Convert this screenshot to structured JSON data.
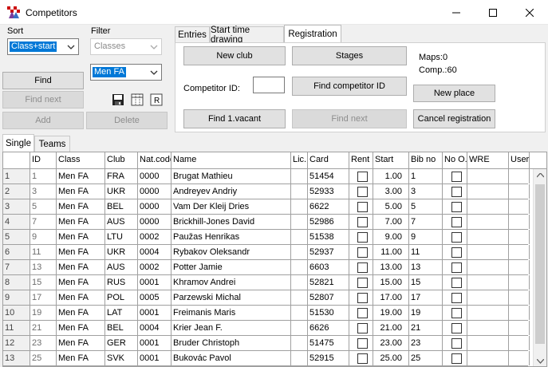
{
  "window": {
    "title": "Competitors",
    "icon": "app-icon"
  },
  "sort": {
    "label": "Sort",
    "value": "Class+start"
  },
  "filter": {
    "label": "Filter",
    "class_filter": "Classes",
    "class_value": "Men FA"
  },
  "left_buttons": {
    "find": "Find",
    "find_next": "Find next",
    "add": "Add",
    "delete": "Delete"
  },
  "small_icons": [
    "save-icon",
    "columns-icon",
    "report-icon"
  ],
  "top_tabs": [
    "Entries",
    "Start time drawing",
    "Registration"
  ],
  "registration": {
    "new_club": "New club",
    "stages": "Stages",
    "maps": "Maps:0",
    "comp": "Comp.:60",
    "competitor_id_label": "Competitor ID:",
    "competitor_id_value": "",
    "find_competitor_id": "Find competitor ID",
    "new_place": "New place",
    "find_first_vacant": "Find 1.vacant",
    "find_next": "Find next",
    "cancel_registration": "Cancel registration"
  },
  "bottom_tabs": [
    "Single",
    "Teams"
  ],
  "table": {
    "columns": [
      "",
      "ID",
      "Class",
      "Club",
      "Nat.code",
      "Name",
      "Lic.",
      "Card",
      "Rent",
      "Start",
      "Bib no",
      "No O.",
      "WRE",
      "User"
    ],
    "rows": [
      [
        "1",
        "1",
        "Men FA",
        "FRA",
        "0000",
        "Brugat Mathieu",
        "",
        "51454",
        "",
        "1.00",
        "1",
        "",
        "",
        ""
      ],
      [
        "2",
        "3",
        "Men FA",
        "UKR",
        "0000",
        "Andreyev Andriy",
        "",
        "52933",
        "",
        "3.00",
        "3",
        "",
        "",
        ""
      ],
      [
        "3",
        "5",
        "Men FA",
        "BEL",
        "0000",
        "Vam Der Kleij Dries",
        "",
        "6622",
        "",
        "5.00",
        "5",
        "",
        "",
        ""
      ],
      [
        "4",
        "7",
        "Men FA",
        "AUS",
        "0000",
        "Brickhill-Jones David",
        "",
        "52986",
        "",
        "7.00",
        "7",
        "",
        "",
        ""
      ],
      [
        "5",
        "9",
        "Men FA",
        "LTU",
        "0002",
        "Paužas Henrikas",
        "",
        "51538",
        "",
        "9.00",
        "9",
        "",
        "",
        ""
      ],
      [
        "6",
        "11",
        "Men FA",
        "UKR",
        "0004",
        "Rybakov Oleksandr",
        "",
        "52937",
        "",
        "11.00",
        "11",
        "",
        "",
        ""
      ],
      [
        "7",
        "13",
        "Men FA",
        "AUS",
        "0002",
        "Potter Jamie",
        "",
        "6603",
        "",
        "13.00",
        "13",
        "",
        "",
        ""
      ],
      [
        "8",
        "15",
        "Men FA",
        "RUS",
        "0001",
        "Khramov Andrei",
        "",
        "52821",
        "",
        "15.00",
        "15",
        "",
        "",
        ""
      ],
      [
        "9",
        "17",
        "Men FA",
        "POL",
        "0005",
        "Parzewski Michal",
        "",
        "52807",
        "",
        "17.00",
        "17",
        "",
        "",
        ""
      ],
      [
        "10",
        "19",
        "Men FA",
        "LAT",
        "0001",
        "Freimanis Maris",
        "",
        "51530",
        "",
        "19.00",
        "19",
        "",
        "",
        ""
      ],
      [
        "11",
        "21",
        "Men FA",
        "BEL",
        "0004",
        "Krier Jean F.",
        "",
        "6626",
        "",
        "21.00",
        "21",
        "",
        "",
        ""
      ],
      [
        "12",
        "23",
        "Men FA",
        "GER",
        "0001",
        "Bruder Christoph",
        "",
        "51475",
        "",
        "23.00",
        "23",
        "",
        "",
        ""
      ],
      [
        "13",
        "25",
        "Men FA",
        "SVK",
        "0001",
        "Bukovác Pavol",
        "",
        "52915",
        "",
        "25.00",
        "25",
        "",
        "",
        ""
      ]
    ]
  },
  "colors": {
    "selection": "#0078d7",
    "grid_line": "#a0a0a0"
  }
}
